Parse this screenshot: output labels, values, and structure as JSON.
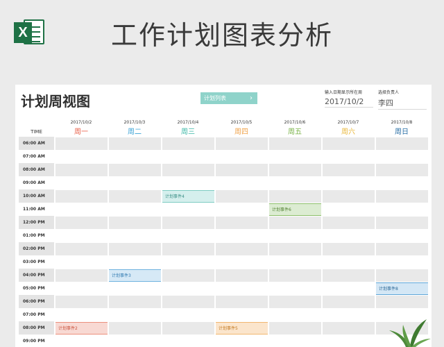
{
  "banner": {
    "title": "工作计划图表分析",
    "logo_letter": "X"
  },
  "sheet": {
    "title": "计划周视图",
    "plan_list_button": "计划列表",
    "plan_list_chevron": "›",
    "date_label": "输入日期显示所在周",
    "date_value": "2017/10/2",
    "owner_label": "选择负责人",
    "owner_value": "李四",
    "time_header": "TIME"
  },
  "days": [
    {
      "date": "2017/10/2",
      "weekday": "周一",
      "color": "#e8604a"
    },
    {
      "date": "2017/10/3",
      "weekday": "周二",
      "color": "#3aa3d6"
    },
    {
      "date": "2017/10/4",
      "weekday": "周三",
      "color": "#3bb7a6"
    },
    {
      "date": "2017/10/5",
      "weekday": "周四",
      "color": "#f0a34a"
    },
    {
      "date": "2017/10/6",
      "weekday": "周五",
      "color": "#7ab348"
    },
    {
      "date": "2017/10/7",
      "weekday": "周六",
      "color": "#e9b73a"
    },
    {
      "date": "2017/10/8",
      "weekday": "周日",
      "color": "#2a6fa6"
    }
  ],
  "times": [
    "06:00 AM",
    "07:00 AM",
    "08:00 AM",
    "09:00 AM",
    "10:00 AM",
    "11:00 AM",
    "12:00 PM",
    "01:00 PM",
    "02:00 PM",
    "03:00 PM",
    "04:00 PM",
    "05:00 PM",
    "06:00 PM",
    "07:00 PM",
    "08:00 PM",
    "09:00 PM"
  ],
  "events": [
    {
      "label": "计划事件4",
      "day": 2,
      "slot": 4,
      "bg": "#d5efed",
      "border": "#7dcbc2",
      "text": "#3a8f86"
    },
    {
      "label": "计划事件6",
      "day": 4,
      "slot": 5,
      "bg": "#dcecd2",
      "border": "#8dbf6a",
      "text": "#4f7f2f"
    },
    {
      "label": "计划事件3",
      "day": 1,
      "slot": 10,
      "bg": "#d6e9f6",
      "border": "#6fb2df",
      "text": "#2f7ab0"
    },
    {
      "label": "计划事件8",
      "day": 6,
      "slot": 11,
      "bg": "#d4e7f5",
      "border": "#5fa6d8",
      "text": "#2a6796"
    },
    {
      "label": "计划事件2",
      "day": 0,
      "slot": 14,
      "bg": "#f8d9d3",
      "border": "#ec8f7c",
      "text": "#c9533d"
    },
    {
      "label": "计划事件5",
      "day": 3,
      "slot": 14,
      "bg": "#fbe5cc",
      "border": "#f1b66f",
      "text": "#c47a22"
    }
  ]
}
